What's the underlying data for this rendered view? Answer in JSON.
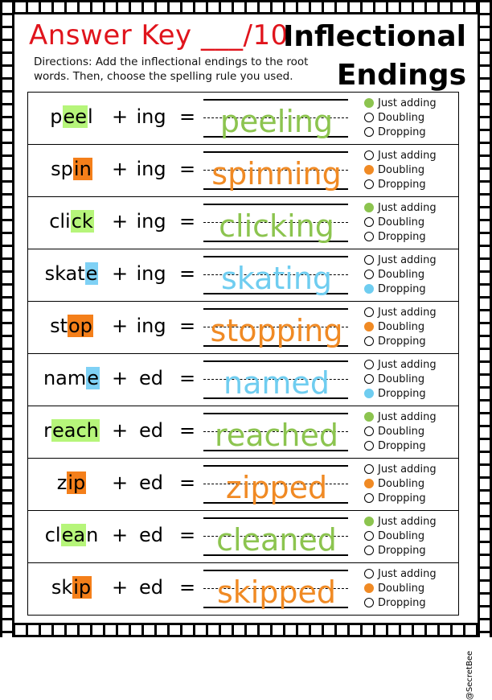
{
  "header": {
    "title_left": "Answer Key",
    "score": "___/10",
    "title_right_line1": "Inflectional",
    "title_right_line2": "Endings",
    "directions": "Directions: Add the inflectional endings to the root words. Then, choose the spelling rule you used."
  },
  "colors": {
    "title_red": "#e0141c",
    "green": "#8cc44f",
    "green_highlight": "#b6f57a",
    "orange": "#f08a24",
    "orange_highlight": "#f47f1a",
    "blue": "#6fcdf0",
    "blue_highlight": "#7fd1f5"
  },
  "options": [
    "Just adding",
    "Doubling",
    "Dropping"
  ],
  "rows": [
    {
      "pre": "p",
      "hl": "ee",
      "post": "l",
      "suffix": "ing",
      "answer": "peeling",
      "choice": 0,
      "color": "green"
    },
    {
      "pre": "sp",
      "hl": "in",
      "post": "",
      "suffix": "ing",
      "answer": "spinning",
      "choice": 1,
      "color": "orange"
    },
    {
      "pre": "cli",
      "hl": "ck",
      "post": "",
      "suffix": "ing",
      "answer": "clicking",
      "choice": 0,
      "color": "green"
    },
    {
      "pre": "skat",
      "hl": "e",
      "post": "",
      "suffix": "ing",
      "answer": "skating",
      "choice": 2,
      "color": "blue"
    },
    {
      "pre": "st",
      "hl": "op",
      "post": "",
      "suffix": "ing",
      "answer": "stopping",
      "choice": 1,
      "color": "orange"
    },
    {
      "pre": "nam",
      "hl": "e",
      "post": "",
      "suffix": "ed",
      "answer": "named",
      "choice": 2,
      "color": "blue"
    },
    {
      "pre": "r",
      "hl": "each",
      "post": "",
      "suffix": "ed",
      "answer": "reached",
      "choice": 0,
      "color": "green"
    },
    {
      "pre": "z",
      "hl": "ip",
      "post": "",
      "suffix": "ed",
      "answer": "zipped",
      "choice": 1,
      "color": "orange"
    },
    {
      "pre": "cl",
      "hl": "ea",
      "post": "n",
      "suffix": "ed",
      "answer": "cleaned",
      "choice": 0,
      "color": "green"
    },
    {
      "pre": "sk",
      "hl": "ip",
      "post": "",
      "suffix": "ed",
      "answer": "skipped",
      "choice": 1,
      "color": "orange"
    }
  ],
  "symbols": {
    "plus": "+",
    "equals": "="
  },
  "credit": "@SecretBee"
}
